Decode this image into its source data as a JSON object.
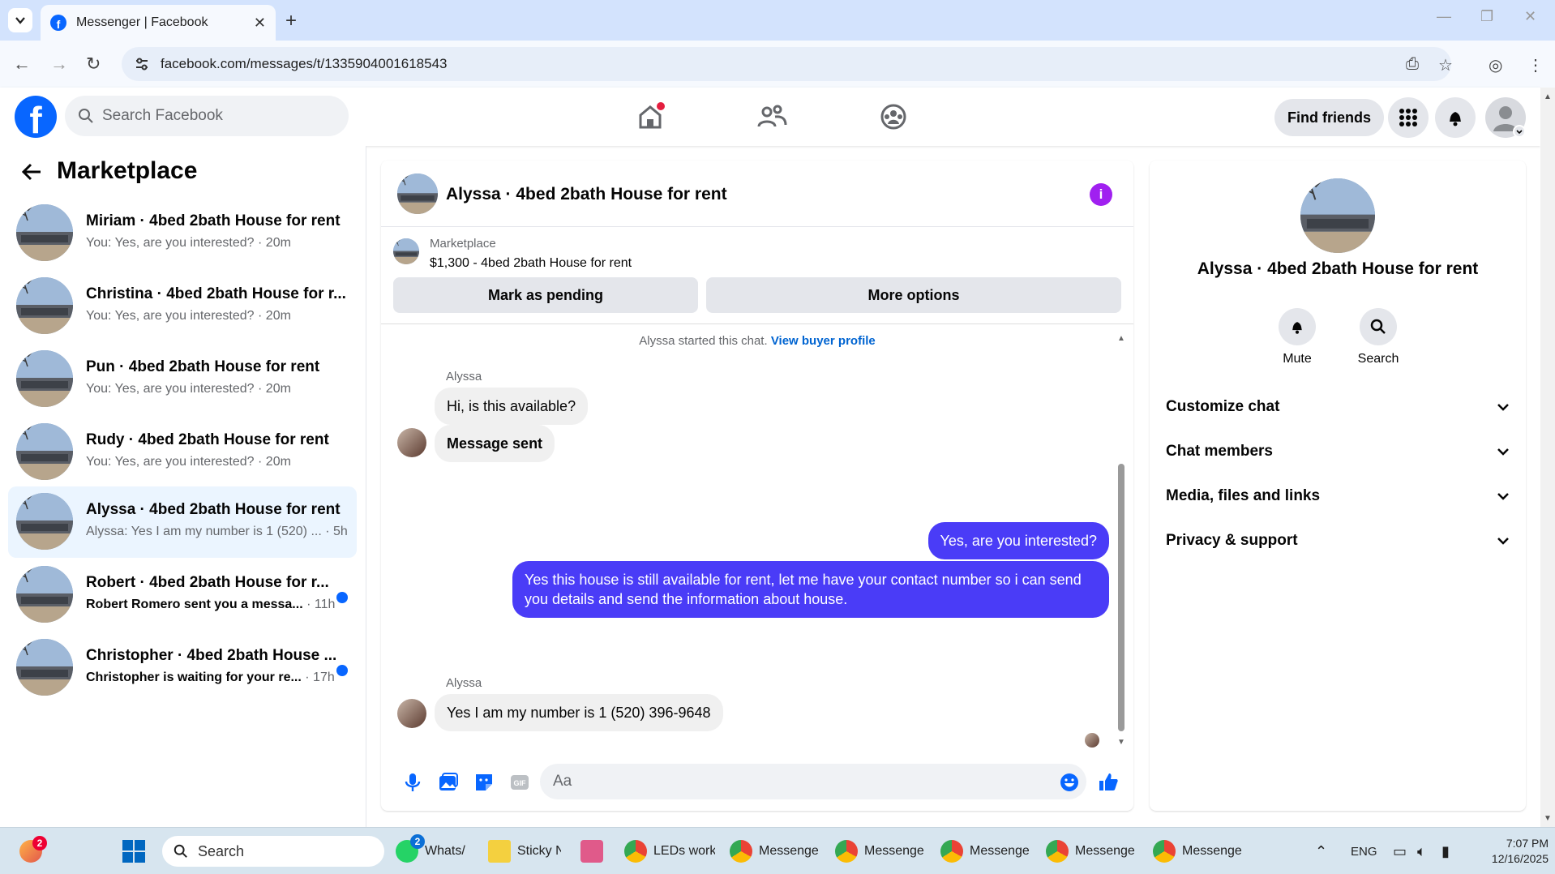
{
  "browser": {
    "tab_title": "Messenger | Facebook",
    "url": "facebook.com/messages/t/1335904001618543"
  },
  "header": {
    "search_placeholder": "Search Facebook",
    "find_friends_label": "Find friends"
  },
  "sidebar": {
    "title": "Marketplace",
    "conversations": [
      {
        "title": "Miriam · 4bed 2bath House for rent",
        "snippet": "You: Yes, are you interested?",
        "time": "· 20m",
        "unread": false,
        "active": false
      },
      {
        "title": "Christina · 4bed 2bath House for r...",
        "snippet": "You: Yes, are you interested?",
        "time": "· 20m",
        "unread": false,
        "active": false
      },
      {
        "title": "Pun · 4bed 2bath House for rent",
        "snippet": "You: Yes, are you interested?",
        "time": "· 20m",
        "unread": false,
        "active": false
      },
      {
        "title": "Rudy · 4bed 2bath House for rent",
        "snippet": "You: Yes, are you interested?",
        "time": "· 20m",
        "unread": false,
        "active": false
      },
      {
        "title": "Alyssa · 4bed 2bath House for rent",
        "snippet": "Alyssa: Yes I am my number is 1 (520) ...",
        "time": "· 5h",
        "unread": false,
        "active": true
      },
      {
        "title": "Robert · 4bed 2bath House for r...",
        "snippet": "Robert Romero sent you a messa...",
        "time": "· 11h",
        "unread": true,
        "active": false
      },
      {
        "title": "Christopher · 4bed 2bath House ...",
        "snippet": "Christopher is waiting for your re...",
        "time": "· 17h",
        "unread": true,
        "active": false
      }
    ]
  },
  "chat": {
    "title": "Alyssa · 4bed 2bath House for rent",
    "marketplace_label": "Marketplace",
    "listing": "$1,300 - 4bed 2bath House for rent",
    "mark_pending_label": "Mark as pending",
    "more_options_label": "More options",
    "system_note": "Alyssa started this chat.",
    "view_buyer_profile": "View buyer profile",
    "messages": [
      {
        "sender": "Alyssa",
        "text": "Hi, is this available?"
      },
      {
        "text": "Message sent"
      },
      {
        "text": "Yes, are you interested?"
      },
      {
        "text": "Yes this house is still available for rent, let me have your contact number so i can send you details and send the information about house."
      },
      {
        "sender": "Alyssa",
        "text": "Yes I am my number is 1 (520) 396-9648"
      }
    ],
    "composer_placeholder": "Aa"
  },
  "details": {
    "title": "Alyssa · 4bed 2bath House for rent",
    "mute_label": "Mute",
    "search_label": "Search",
    "sections": [
      "Customize chat",
      "Chat members",
      "Media, files and links",
      "Privacy & support"
    ]
  },
  "taskbar": {
    "search_label": "Search",
    "items": [
      "Whats/",
      "Sticky N",
      "LEDs work",
      "Messenge",
      "Messenge",
      "Messenge",
      "Messenge",
      "Messenge"
    ],
    "badge_left": "2",
    "badge_whatsapp": "2",
    "lang": "ENG",
    "time": "7:07 PM",
    "date": "12/16/2025"
  },
  "colors": {
    "fb_blue": "#0866ff",
    "outgoing_bubble": "#4a3cf7",
    "info_purple": "#a020f0"
  }
}
